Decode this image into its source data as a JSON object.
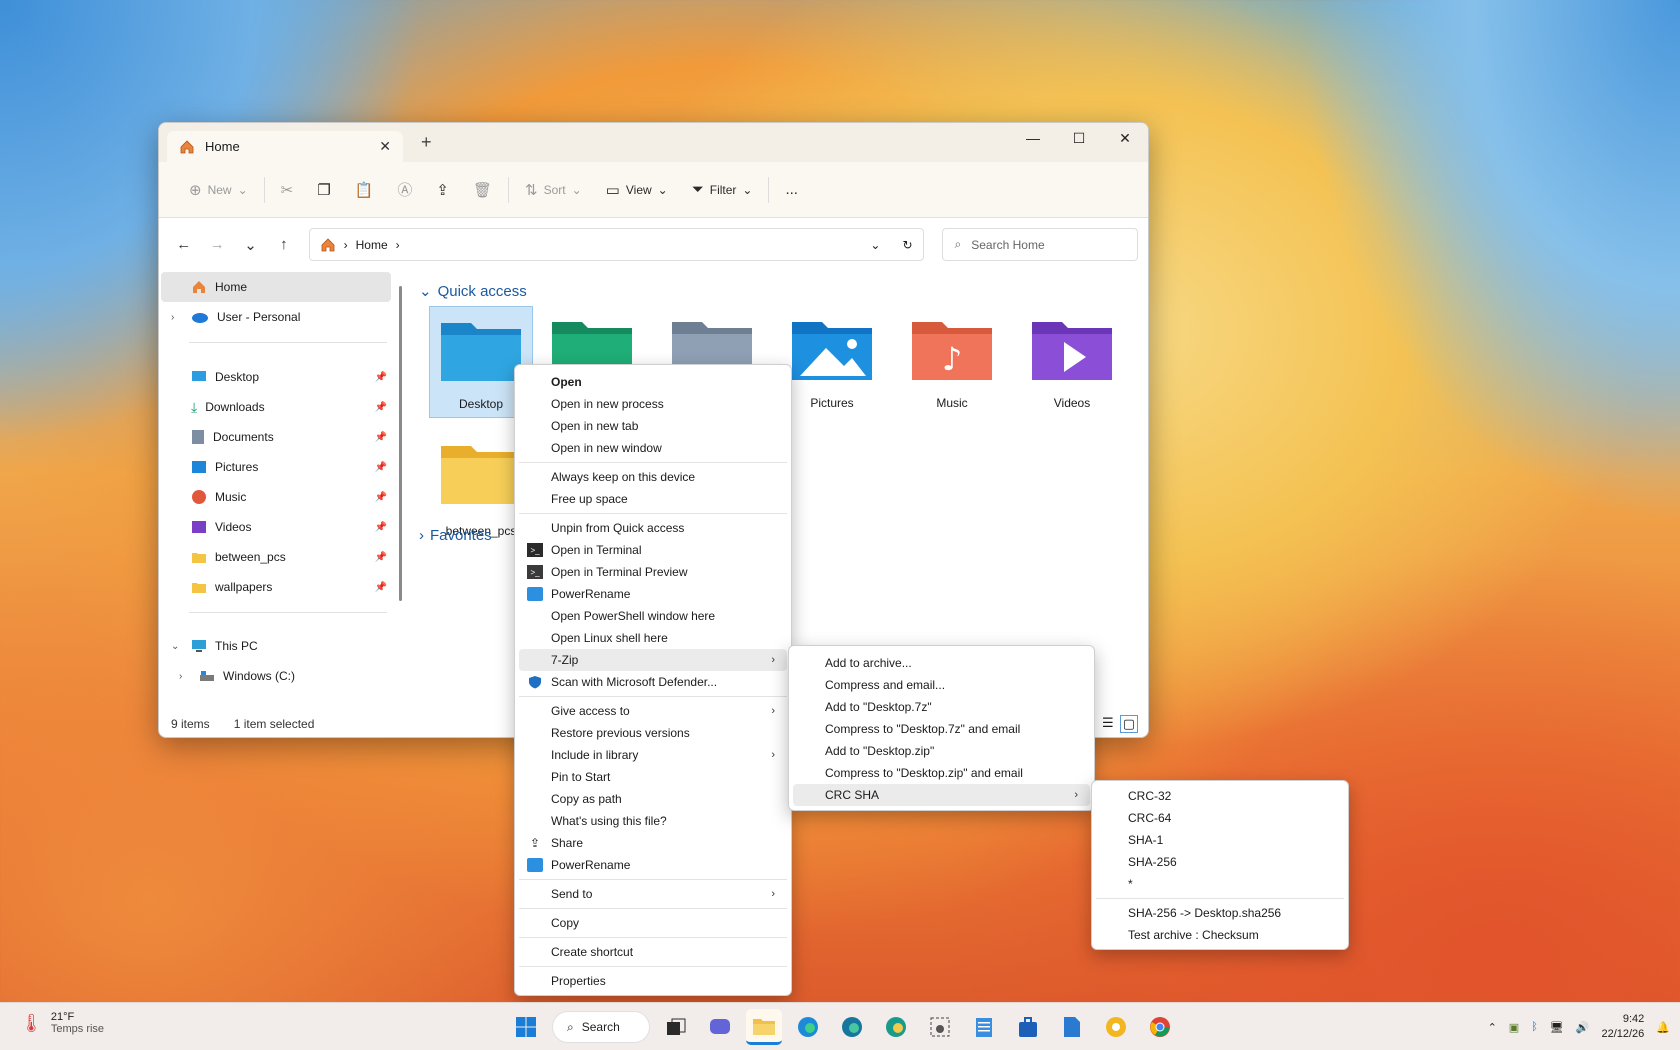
{
  "window": {
    "tab_title": "Home",
    "toolbar": {
      "new": "New",
      "sort": "Sort",
      "view": "View",
      "filter": "Filter",
      "more": "..."
    },
    "breadcrumb": {
      "root": "Home"
    },
    "search_placeholder": "Search Home",
    "sidebar": {
      "home": "Home",
      "user": "User - Personal",
      "pinned": [
        {
          "label": "Desktop",
          "icon": "desktop-icon"
        },
        {
          "label": "Downloads",
          "icon": "download-icon"
        },
        {
          "label": "Documents",
          "icon": "document-icon"
        },
        {
          "label": "Pictures",
          "icon": "pictures-icon"
        },
        {
          "label": "Music",
          "icon": "music-icon"
        },
        {
          "label": "Videos",
          "icon": "videos-icon"
        },
        {
          "label": "between_pcs",
          "icon": "folder-icon"
        },
        {
          "label": "wallpapers",
          "icon": "folder-icon"
        }
      ],
      "this_pc": "This PC",
      "drive": "Windows (C:)"
    },
    "quick_access": {
      "header": "Quick access",
      "tiles": [
        {
          "label": "Desktop"
        },
        {
          "label": ""
        },
        {
          "label": ""
        },
        {
          "label": "Pictures"
        },
        {
          "label": "Music"
        },
        {
          "label": "Videos"
        },
        {
          "label": "between_pcs"
        }
      ]
    },
    "favorites_header": "Favorites",
    "status": {
      "items": "9 items",
      "selected": "1 item selected"
    }
  },
  "context_menu": {
    "items": [
      "Open",
      "Open in new process",
      "Open in new tab",
      "Open in new window",
      "Always keep on this device",
      "Free up space",
      "Unpin from Quick access",
      "Open in Terminal",
      "Open in Terminal Preview",
      "PowerRename",
      "Open PowerShell window here",
      "Open Linux shell here",
      "7-Zip",
      "Scan with Microsoft Defender...",
      "Give access to",
      "Restore previous versions",
      "Include in library",
      "Pin to Start",
      "Copy as path",
      "What's using this file?",
      "Share",
      "PowerRename",
      "Send to",
      "Copy",
      "Create shortcut",
      "Properties"
    ]
  },
  "zip_menu": {
    "items": [
      "Add to archive...",
      "Compress and email...",
      "Add to \"Desktop.7z\"",
      "Compress to \"Desktop.7z\" and email",
      "Add to \"Desktop.zip\"",
      "Compress to \"Desktop.zip\" and email",
      "CRC SHA"
    ]
  },
  "crc_menu": {
    "items": [
      "CRC-32",
      "CRC-64",
      "SHA-1",
      "SHA-256",
      "*",
      "SHA-256 -> Desktop.sha256",
      "Test archive : Checksum"
    ]
  },
  "taskbar": {
    "weather_temp": "21°F",
    "weather_desc": "Temps rise",
    "search": "Search",
    "time": "9:42",
    "date": "22/12/26"
  }
}
